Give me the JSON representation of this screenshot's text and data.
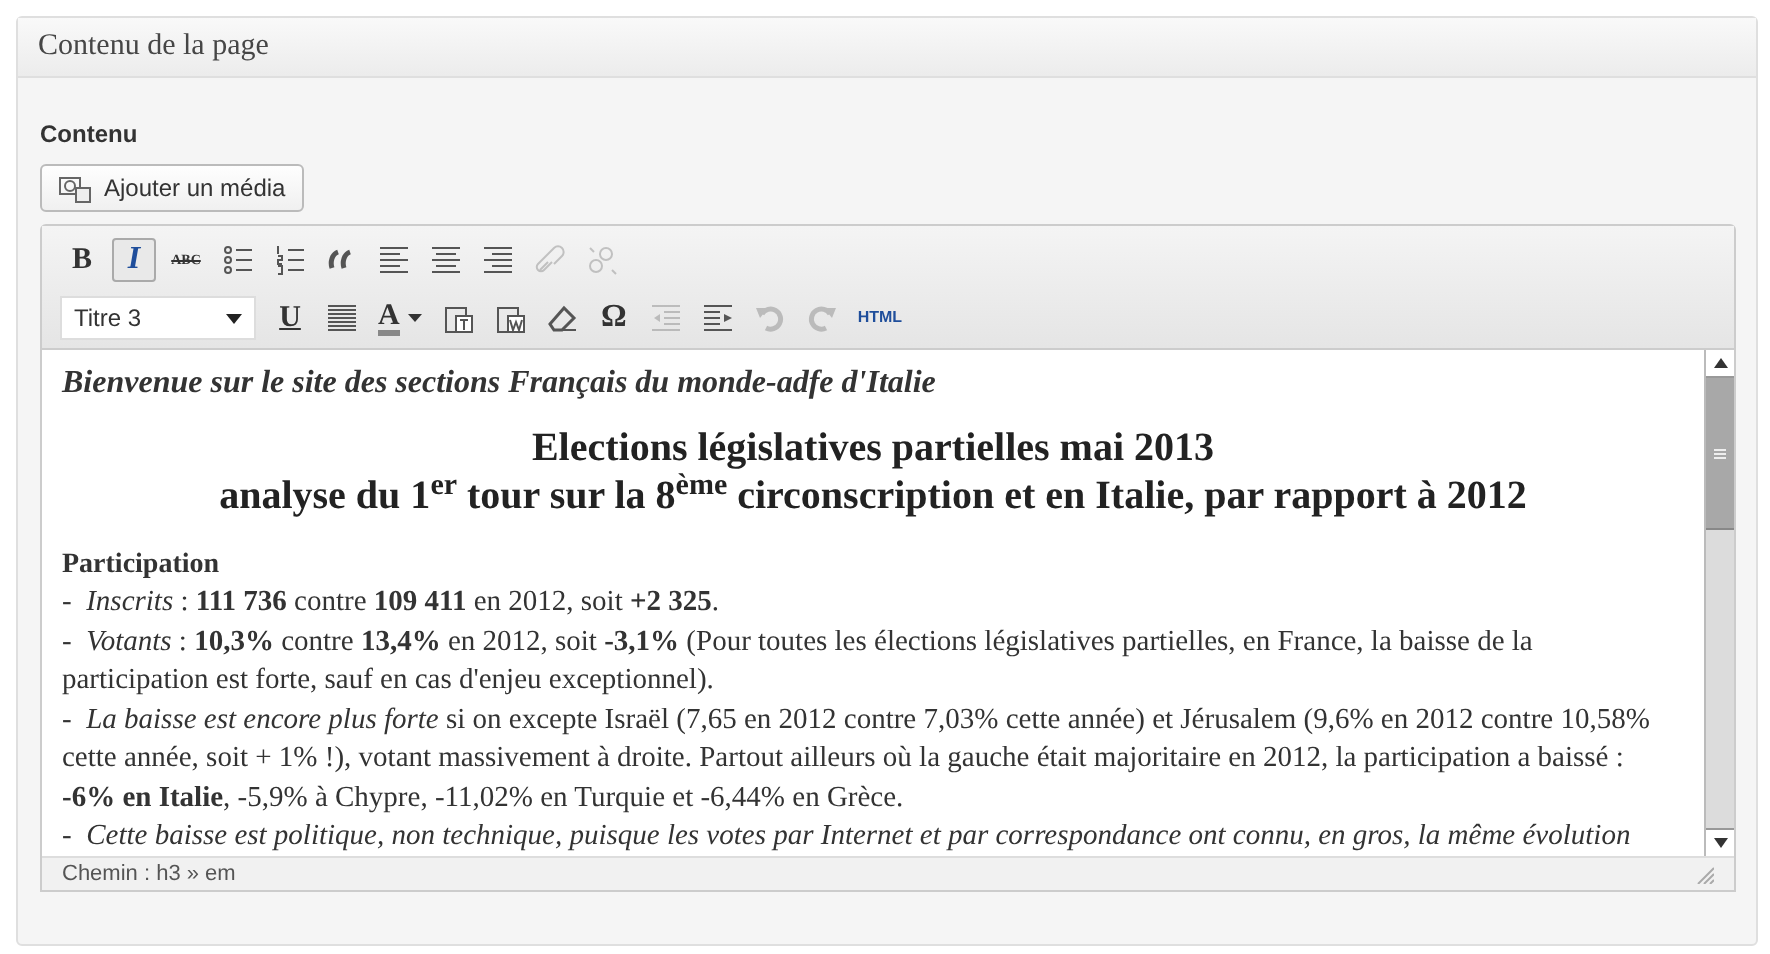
{
  "panel": {
    "title": "Contenu de la page"
  },
  "field_label": "Contenu",
  "media_button": {
    "label": "Ajouter un média"
  },
  "toolbar": {
    "top_row": [
      {
        "kind": "bold",
        "label": "B",
        "active": false,
        "disabled": false
      },
      {
        "kind": "italic",
        "label": "I",
        "active": true,
        "disabled": false
      },
      {
        "kind": "strike",
        "label": "ABC",
        "active": false,
        "disabled": false
      },
      {
        "kind": "bullets",
        "active": false,
        "disabled": false
      },
      {
        "kind": "numbers",
        "active": false,
        "disabled": false
      },
      {
        "kind": "quote",
        "active": false,
        "disabled": false
      },
      {
        "kind": "align-left",
        "active": false,
        "disabled": false
      },
      {
        "kind": "align-center",
        "active": false,
        "disabled": false
      },
      {
        "kind": "align-right",
        "active": false,
        "disabled": false
      },
      {
        "kind": "link",
        "active": false,
        "disabled": true
      },
      {
        "kind": "unlink",
        "active": false,
        "disabled": true
      }
    ],
    "bottom_row": [
      {
        "kind": "format",
        "label": "Titre 3"
      },
      {
        "kind": "underline",
        "label": "U",
        "active": false,
        "disabled": false
      },
      {
        "kind": "justify",
        "active": false,
        "disabled": false
      },
      {
        "kind": "color",
        "label": "A",
        "active": false,
        "disabled": false
      },
      {
        "kind": "paste-text",
        "active": false,
        "disabled": false
      },
      {
        "kind": "paste-word",
        "active": false,
        "disabled": false
      },
      {
        "kind": "eraser",
        "active": false,
        "disabled": false
      },
      {
        "kind": "omega",
        "label": "Ω",
        "active": false,
        "disabled": false
      },
      {
        "kind": "outdent",
        "active": false,
        "disabled": true
      },
      {
        "kind": "indent",
        "active": false,
        "disabled": false
      },
      {
        "kind": "undo",
        "active": false,
        "disabled": true
      },
      {
        "kind": "redo",
        "active": false,
        "disabled": true
      },
      {
        "kind": "html",
        "label": "HTML",
        "active": false,
        "disabled": false
      }
    ]
  },
  "content": [
    {
      "kind": "intro",
      "text": "Bienvenue sur le site des sections Français du monde-adfe d'Italie"
    },
    {
      "kind": "heading",
      "text": "Elections législatives partielles mai 2013"
    },
    {
      "kind": "heading",
      "text": "analyse du 1$^{er}$ tour sur la 8$^{ème}$ circonscription et en Italie, par rapport à 2012"
    },
    {
      "kind": "subheading",
      "text": "Participation"
    },
    {
      "kind": "text",
      "text": "-  *Inscrits* : **111 736** contre **109 411** en 2012, soit **+2 325**."
    },
    {
      "kind": "text",
      "text": "-  *Votants* : **10,3%** contre **13,4%** en 2012, soit **-3,1%** (Pour toutes les élections législatives partielles, en France, la baisse de la participation est forte, sauf en cas d'enjeu exceptionnel)."
    },
    {
      "kind": "text",
      "text": "-  *La baisse est encore plus forte* si on excepte Israël (7,65 en 2012 contre 7,03% cette année) et Jérusalem (9,6% en 2012 contre 10,58% cette année, soit + 1% !), votant massivement à droite. Partout ailleurs où la gauche était majoritaire en 2012, la participation a baissé : **-6% en Italie**, -5,9% à Chypre, -11,02% en Turquie et -6,44% en Grèce."
    },
    {
      "kind": "text",
      "text": "-  *Cette baisse est politique, non technique, puisque les votes par Internet et par correspondance ont connu, en gros, la même évolution*"
    }
  ],
  "status_bar": {
    "path": "Chemin : h3 » em"
  }
}
